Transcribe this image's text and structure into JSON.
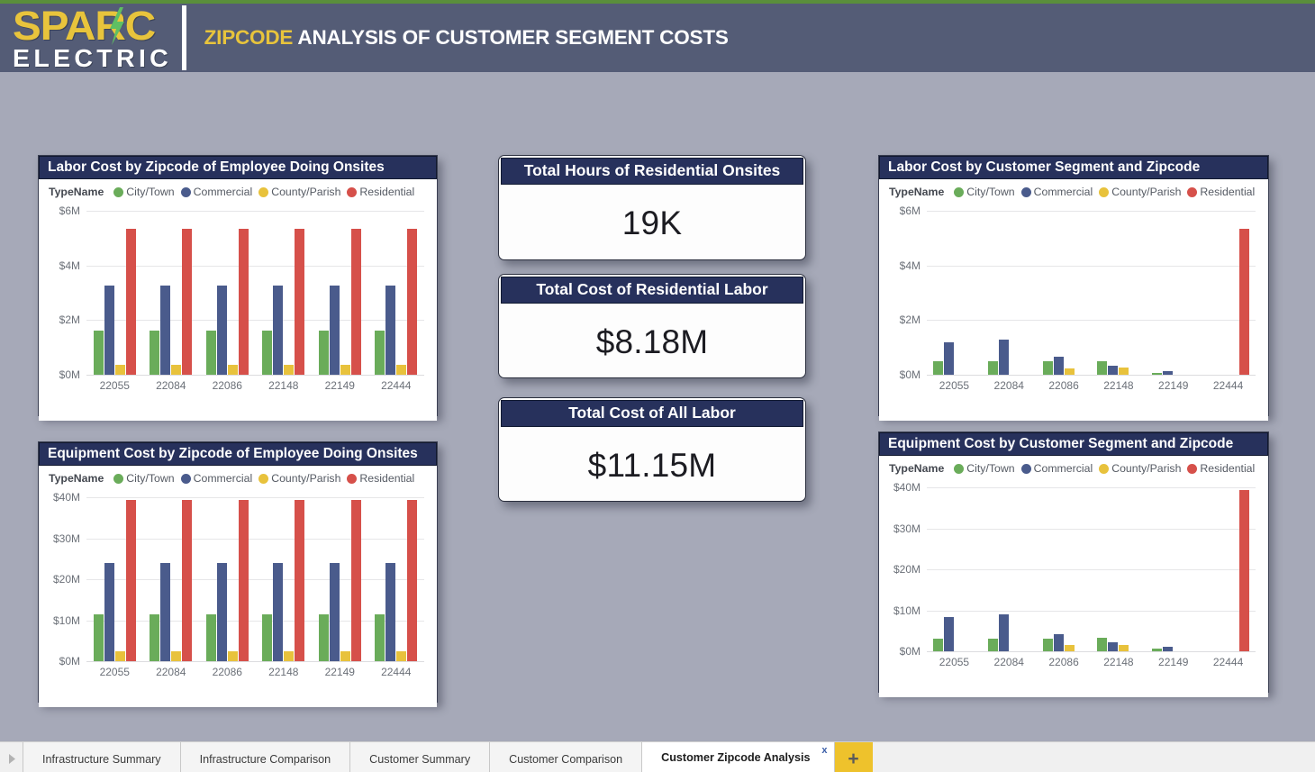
{
  "header": {
    "logo_sparc": "SPARC",
    "logo_electric": "ELECTRIC",
    "title_accent": "ZIPCODE",
    "title_rest": " ANALYSIS OF CUSTOMER SEGMENT COSTS",
    "accent_color": "#e8c43c",
    "bar_color": "#545c76",
    "top_strip_color": "#5a8f3c"
  },
  "colors": {
    "panel_header": "#27315c",
    "canvas_background": "#a6a9b8",
    "city_town": "#6aac5a",
    "commercial": "#4a5b8c",
    "county_parish": "#e8c23c",
    "residential": "#d6504a",
    "tab_accent": "#eec22c"
  },
  "legend": {
    "title": "TypeName",
    "entries": [
      {
        "label": "City/Town",
        "color": "#6aac5a"
      },
      {
        "label": "Commercial",
        "color": "#4a5b8c"
      },
      {
        "label": "County/Parish",
        "color": "#e8c23c"
      },
      {
        "label": "Residential",
        "color": "#d6504a"
      }
    ]
  },
  "kpis": [
    {
      "title": "Total Hours of Residential Onsites",
      "value": "19K"
    },
    {
      "title": "Total Cost of Residential Labor",
      "value": "$8.18M"
    },
    {
      "title": "Total Cost of All Labor",
      "value": "$11.15M"
    }
  ],
  "chart_data": [
    {
      "id": "labor-by-employee-zipcode",
      "type": "bar",
      "title": "Labor Cost by Zipcode of Employee Doing Onsites",
      "xlabel": "",
      "ylabel": "",
      "ylim": [
        0,
        6000000
      ],
      "ytick_labels": [
        "$0M",
        "$2M",
        "$4M",
        "$6M"
      ],
      "ytick_values": [
        0,
        2000000,
        4000000,
        6000000
      ],
      "grid": true,
      "legend_position": "top",
      "categories": [
        "22055",
        "22084",
        "22086",
        "22148",
        "22149",
        "22444"
      ],
      "series": [
        {
          "name": "City/Town",
          "color": "#6aac5a",
          "values": [
            1630000,
            1630000,
            1630000,
            1630000,
            1630000,
            1630000
          ]
        },
        {
          "name": "Commercial",
          "color": "#4a5b8c",
          "values": [
            3280000,
            3280000,
            3280000,
            3280000,
            3280000,
            3280000
          ]
        },
        {
          "name": "County/Parish",
          "color": "#e8c23c",
          "values": [
            350000,
            350000,
            350000,
            350000,
            350000,
            350000
          ]
        },
        {
          "name": "Residential",
          "color": "#d6504a",
          "values": [
            5350000,
            5350000,
            5350000,
            5350000,
            5350000,
            5350000
          ]
        }
      ]
    },
    {
      "id": "equipment-by-employee-zipcode",
      "type": "bar",
      "title": "Equipment Cost by Zipcode of Employee Doing Onsites",
      "xlabel": "",
      "ylabel": "",
      "ylim": [
        0,
        40000000
      ],
      "ytick_labels": [
        "$0M",
        "$10M",
        "$20M",
        "$30M",
        "$40M"
      ],
      "ytick_values": [
        0,
        10000000,
        20000000,
        30000000,
        40000000
      ],
      "grid": true,
      "legend_position": "top",
      "categories": [
        "22055",
        "22084",
        "22086",
        "22148",
        "22149",
        "22444"
      ],
      "series": [
        {
          "name": "City/Town",
          "color": "#6aac5a",
          "values": [
            11400000,
            11400000,
            11400000,
            11400000,
            11400000,
            11400000
          ]
        },
        {
          "name": "Commercial",
          "color": "#4a5b8c",
          "values": [
            24000000,
            24000000,
            24000000,
            24000000,
            24000000,
            24000000
          ]
        },
        {
          "name": "County/Parish",
          "color": "#e8c23c",
          "values": [
            2400000,
            2400000,
            2400000,
            2400000,
            2400000,
            2400000
          ]
        },
        {
          "name": "Residential",
          "color": "#d6504a",
          "values": [
            39300000,
            39300000,
            39300000,
            39300000,
            39300000,
            39300000
          ]
        }
      ]
    },
    {
      "id": "labor-by-customer-segment-zipcode",
      "type": "bar",
      "title": "Labor Cost by Customer Segment and Zipcode",
      "xlabel": "",
      "ylabel": "",
      "ylim": [
        0,
        6000000
      ],
      "ytick_labels": [
        "$0M",
        "$2M",
        "$4M",
        "$6M"
      ],
      "ytick_values": [
        0,
        2000000,
        4000000,
        6000000
      ],
      "grid": true,
      "legend_position": "top",
      "categories": [
        "22055",
        "22084",
        "22086",
        "22148",
        "22149",
        "22444"
      ],
      "series": [
        {
          "name": "City/Town",
          "color": "#6aac5a",
          "values": [
            480000,
            500000,
            490000,
            510000,
            80000,
            0
          ]
        },
        {
          "name": "Commercial",
          "color": "#4a5b8c",
          "values": [
            1190000,
            1300000,
            660000,
            330000,
            140000,
            0
          ]
        },
        {
          "name": "County/Parish",
          "color": "#e8c23c",
          "values": [
            0,
            0,
            230000,
            250000,
            0,
            0
          ]
        },
        {
          "name": "Residential",
          "color": "#d6504a",
          "values": [
            0,
            0,
            0,
            0,
            0,
            5350000
          ]
        }
      ]
    },
    {
      "id": "equipment-by-customer-segment-zipcode",
      "type": "bar",
      "title": "Equipment Cost by Customer Segment and Zipcode",
      "xlabel": "",
      "ylabel": "",
      "ylim": [
        0,
        40000000
      ],
      "ytick_labels": [
        "$0M",
        "$10M",
        "$20M",
        "$30M",
        "$40M"
      ],
      "ytick_values": [
        0,
        10000000,
        20000000,
        30000000,
        40000000
      ],
      "grid": true,
      "legend_position": "top",
      "categories": [
        "22055",
        "22084",
        "22086",
        "22148",
        "22149",
        "22444"
      ],
      "series": [
        {
          "name": "City/Town",
          "color": "#6aac5a",
          "values": [
            3000000,
            3100000,
            3100000,
            3300000,
            600000,
            0
          ]
        },
        {
          "name": "Commercial",
          "color": "#4a5b8c",
          "values": [
            8400000,
            9000000,
            4200000,
            2200000,
            1000000,
            0
          ]
        },
        {
          "name": "County/Parish",
          "color": "#e8c23c",
          "values": [
            0,
            0,
            1500000,
            1500000,
            0,
            0
          ]
        },
        {
          "name": "Residential",
          "color": "#d6504a",
          "values": [
            0,
            0,
            0,
            0,
            0,
            39300000
          ]
        }
      ]
    }
  ],
  "tabbar": {
    "scroll_left_icon": "chevron-right-icon",
    "tabs": [
      {
        "label": "Infrastructure Summary",
        "active": false
      },
      {
        "label": "Infrastructure Comparison",
        "active": false
      },
      {
        "label": "Customer Summary",
        "active": false
      },
      {
        "label": "Customer Comparison",
        "active": false
      },
      {
        "label": "Customer Zipcode Analysis",
        "active": true,
        "close_label": "x"
      }
    ],
    "add_label": "+"
  }
}
